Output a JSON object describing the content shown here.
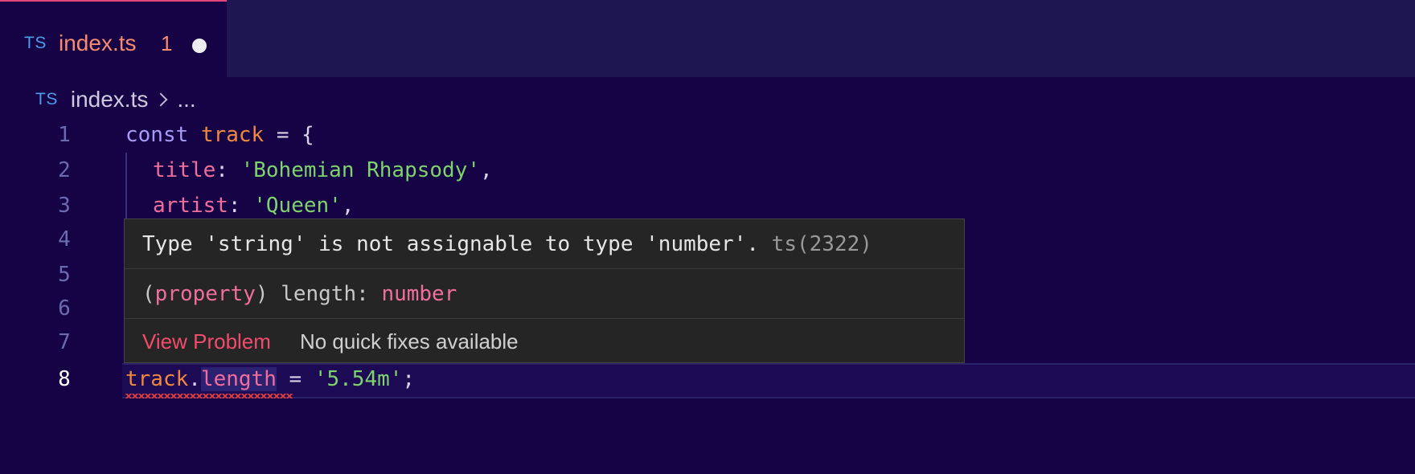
{
  "tab": {
    "icon": "TS",
    "name": "index.ts",
    "problem_count": "1"
  },
  "breadcrumb": {
    "icon": "TS",
    "file": "index.ts",
    "ellipsis": "..."
  },
  "gutter": [
    "1",
    "2",
    "3",
    "4",
    "5",
    "6",
    "7",
    "8"
  ],
  "code": {
    "line1": {
      "keyword": "const",
      "name": "track",
      "rest": " = {"
    },
    "line2": {
      "prop": "title",
      "colon": ": ",
      "value": "'Bohemian Rhapsody'",
      "comma": ","
    },
    "line3": {
      "prop": "artist",
      "colon": ": ",
      "value": "'Queen'",
      "comma": ","
    },
    "line8": {
      "object": "track",
      "dot": ".",
      "member": "length",
      "assign": " = ",
      "value": "'5.54m'",
      "semi": ";"
    }
  },
  "hover": {
    "message": "Type 'string' is not assignable to type 'number'.",
    "code": "ts(2322)",
    "sig_open": "(",
    "sig_kind": "property",
    "sig_close": ") length: ",
    "sig_type": "number",
    "view_problem": "View Problem",
    "no_fixes": "No quick fixes available"
  },
  "colors": {
    "background": "#150346",
    "error": "#e23b3b",
    "link": "#f14c6b"
  }
}
